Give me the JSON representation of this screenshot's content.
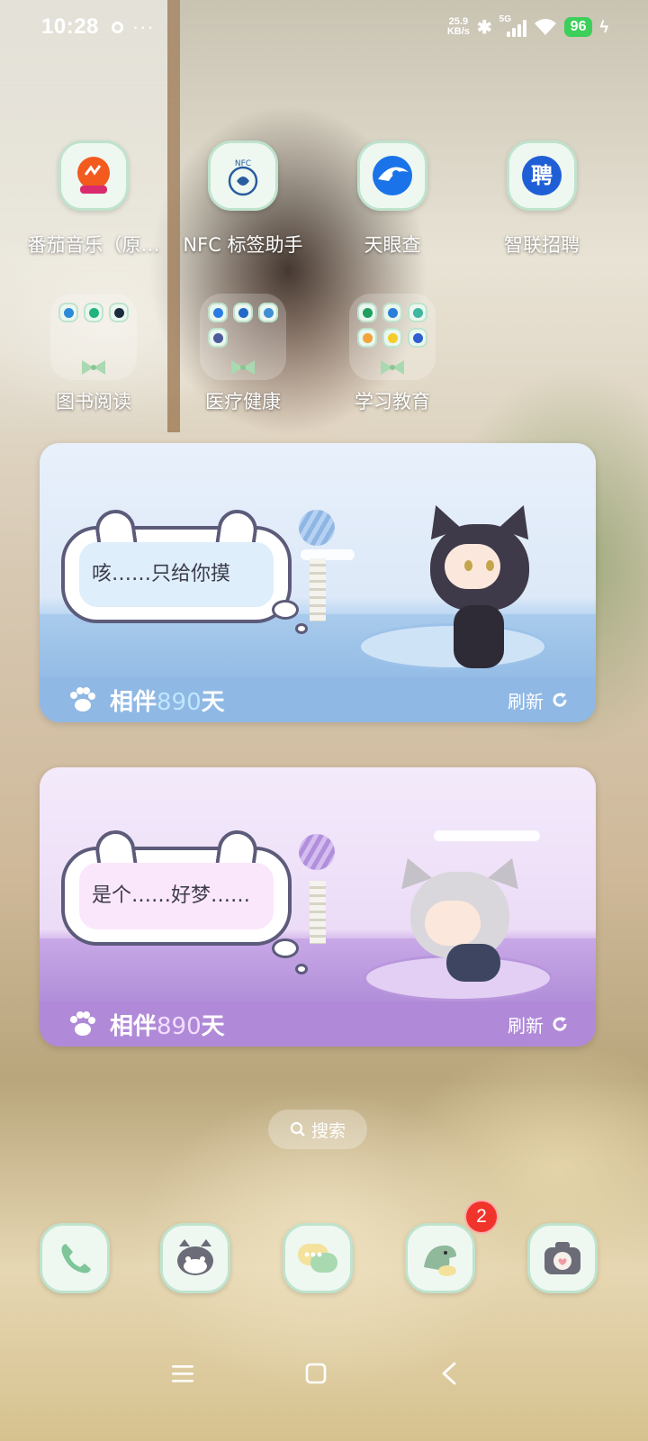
{
  "status_bar": {
    "time": "10:28",
    "more": "···",
    "net_speed_value": "25.9",
    "net_speed_unit": "KB/s",
    "network": "5G",
    "battery": "96"
  },
  "apps": [
    {
      "label": "番茄音乐（原…",
      "icon": "fanqie-music-icon"
    },
    {
      "label": "NFC 标签助手",
      "icon": "nfc-tag-icon",
      "icon_text": "NFC"
    },
    {
      "label": "天眼查",
      "icon": "tianyancha-icon"
    },
    {
      "label": "智联招聘",
      "icon": "zhilian-icon",
      "icon_text": "聘"
    }
  ],
  "folders": [
    {
      "label": "图书阅读"
    },
    {
      "label": "医疗健康"
    },
    {
      "label": "学习教育"
    }
  ],
  "widgets": [
    {
      "speech": "咳……只给你摸",
      "companion_prefix": "相伴",
      "companion_days": "890",
      "companion_suffix": "天",
      "refresh": "刷新"
    },
    {
      "speech": "是个……好梦……",
      "companion_prefix": "相伴",
      "companion_days": "890",
      "companion_suffix": "天",
      "refresh": "刷新"
    }
  ],
  "search": {
    "label": "搜索"
  },
  "dock": [
    {
      "icon": "phone-icon"
    },
    {
      "icon": "cat-face-icon"
    },
    {
      "icon": "messages-icon"
    },
    {
      "icon": "dinosaur-app-icon",
      "badge": "2"
    },
    {
      "icon": "camera-icon"
    }
  ],
  "colors": {
    "icon_bg": "#eef8f1",
    "icon_border": "#bfe3cd",
    "widget1_accent": "#8fb8e4",
    "widget2_accent": "#b08ad8",
    "badge": "#f0342c",
    "battery": "#3ccf5a"
  }
}
